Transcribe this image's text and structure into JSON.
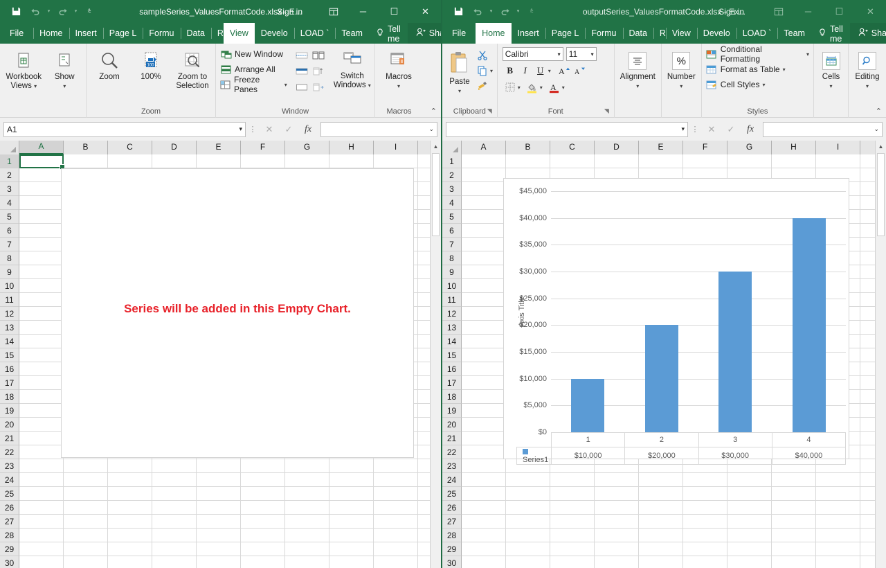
{
  "left_window": {
    "titlebar": {
      "save_icon": "save-icon",
      "undo_icon": "undo-icon",
      "redo_icon": "redo-icon",
      "customize_icon": "customize-qat-icon",
      "title": "sampleSeries_ValuesFormatCode.xlsx",
      "title_suffix": "-  E...",
      "signin": "Sign in",
      "ribbon_display_icon": "ribbon-display-options-icon",
      "minimize": "─",
      "maximize": "☐",
      "close": "✕"
    },
    "tabs": [
      {
        "label": "File",
        "active": false
      },
      {
        "label": "Home",
        "active": false
      },
      {
        "label": "Insert",
        "active": false
      },
      {
        "label": "Page L",
        "active": false
      },
      {
        "label": "Formu",
        "active": false
      },
      {
        "label": "Data",
        "active": false
      },
      {
        "label": "Review",
        "active": false
      },
      {
        "label": "View",
        "active": true
      },
      {
        "label": "Develo",
        "active": false
      },
      {
        "label": "LOAD `",
        "active": false
      },
      {
        "label": "Team",
        "active": false
      }
    ],
    "tellme": "Tell me",
    "share": "Share",
    "ribbon": {
      "groups": [
        {
          "label": "",
          "buttons": [
            {
              "label_line1": "Workbook",
              "label_line2": "Views",
              "icon": "workbook-views-icon",
              "caret": true
            },
            {
              "label_line1": "Show",
              "label_line2": "",
              "icon": "show-icon",
              "caret": true
            }
          ]
        },
        {
          "label": "Zoom",
          "buttons": [
            {
              "label_line1": "Zoom",
              "label_line2": "",
              "icon": "zoom-magnifier-icon",
              "caret": false
            },
            {
              "label_line1": "100%",
              "label_line2": "",
              "icon": "zoom-100-icon",
              "caret": false
            },
            {
              "label_line1": "Zoom to",
              "label_line2": "Selection",
              "icon": "zoom-to-selection-icon",
              "caret": false
            }
          ]
        },
        {
          "label": "Window",
          "items": [
            {
              "label": "New Window",
              "icon": "new-window-icon"
            },
            {
              "label": "Arrange All",
              "icon": "arrange-all-icon"
            },
            {
              "label": "Freeze Panes",
              "icon": "freeze-panes-icon",
              "caret": true
            }
          ],
          "minis": [
            "split-icon",
            "view-side-by-side-icon",
            "hide-icon",
            "synchronous-scrolling-icon",
            "unhide-icon",
            "reset-window-position-icon"
          ],
          "switch_windows": {
            "label_line1": "Switch",
            "label_line2": "Windows",
            "icon": "switch-windows-icon",
            "caret": true
          }
        },
        {
          "label": "Macros",
          "buttons": [
            {
              "label_line1": "Macros",
              "label_line2": "",
              "icon": "macros-icon",
              "caret": true
            }
          ]
        }
      ],
      "collapse_icon": "collapse-ribbon-icon"
    },
    "formula_bar": {
      "name_box_value": "A1",
      "cancel_icon": "cancel-icon",
      "enter_icon": "enter-icon",
      "fx_icon": "insert-function-icon",
      "formula_value": "",
      "expand_icon": "expand-formula-bar-icon"
    },
    "grid": {
      "columns": [
        "A",
        "B",
        "C",
        "D",
        "E",
        "F",
        "G",
        "H",
        "I"
      ],
      "selected_column": "A",
      "rows": [
        1,
        2,
        3,
        4,
        5,
        6,
        7,
        8,
        9,
        10,
        11,
        12,
        13,
        14,
        15,
        16,
        17,
        18,
        19,
        20,
        21,
        22,
        23,
        24,
        25,
        26,
        27,
        28,
        29,
        30
      ],
      "selected_row": 1,
      "selected_cell": "A1"
    },
    "chart_object": {
      "empty_text": "Series will be added in this Empty Chart."
    }
  },
  "right_window": {
    "titlebar": {
      "save_icon": "save-icon",
      "undo_icon": "undo-icon",
      "redo_icon": "redo-icon",
      "customize_icon": "customize-qat-icon",
      "title": "outputSeries_ValuesFormatCode.xlsx",
      "title_suffix": "-  Ex...",
      "signin": "Sign in",
      "ribbon_display_icon": "ribbon-display-options-icon",
      "minimize": "─",
      "maximize": "☐",
      "close": "✕"
    },
    "tabs": [
      {
        "label": "File",
        "active": false
      },
      {
        "label": "Home",
        "active": true
      },
      {
        "label": "Insert",
        "active": false
      },
      {
        "label": "Page L",
        "active": false
      },
      {
        "label": "Formu",
        "active": false
      },
      {
        "label": "Data",
        "active": false
      },
      {
        "label": "Review",
        "active": false
      },
      {
        "label": "View",
        "active": false
      },
      {
        "label": "Develo",
        "active": false
      },
      {
        "label": "LOAD `",
        "active": false
      },
      {
        "label": "Team",
        "active": false
      }
    ],
    "tellme": "Tell me",
    "share": "Share",
    "ribbon": {
      "clipboard": {
        "label": "Clipboard",
        "paste_label": "Paste",
        "paste_icon": "paste-icon",
        "cut_icon": "cut-scissors-icon",
        "copy_icon": "copy-icon",
        "format_painter_icon": "format-painter-icon",
        "dialog_launcher_icon": "dialog-launcher-icon"
      },
      "font": {
        "label": "Font",
        "font_name": "Calibri",
        "font_size": "11",
        "bold": "B",
        "italic": "I",
        "underline": "U",
        "grow_font_icon": "increase-font-size-icon",
        "shrink_font_icon": "decrease-font-size-icon",
        "borders_icon": "borders-icon",
        "fill_color_icon": "fill-color-icon",
        "font_color_icon": "font-color-icon",
        "dialog_launcher_icon": "dialog-launcher-icon"
      },
      "alignment": {
        "label": "Alignment",
        "icon": "alignment-icon"
      },
      "number": {
        "label": "Number",
        "icon": "percent-style-icon"
      },
      "styles": {
        "label": "Styles",
        "items": [
          {
            "label": "Conditional Formatting",
            "icon": "conditional-formatting-icon",
            "caret": true
          },
          {
            "label": "Format as Table",
            "icon": "format-as-table-icon",
            "caret": true
          },
          {
            "label": "Cell Styles",
            "icon": "cell-styles-icon",
            "caret": true
          }
        ]
      },
      "cells": {
        "label": "Cells",
        "icon": "cells-icon",
        "caret": true
      },
      "editing": {
        "label": "Editing",
        "icon": "editing-magnifier-icon",
        "caret": true
      },
      "collapse_icon": "collapse-ribbon-icon"
    },
    "formula_bar": {
      "name_box_value": "",
      "cancel_icon": "cancel-icon",
      "enter_icon": "enter-icon",
      "fx_icon": "insert-function-icon",
      "formula_value": "",
      "expand_icon": "expand-formula-bar-icon"
    },
    "grid": {
      "columns": [
        "A",
        "B",
        "C",
        "D",
        "E",
        "F",
        "G",
        "H",
        "I"
      ],
      "rows": [
        1,
        2,
        3,
        4,
        5,
        6,
        7,
        8,
        9,
        10,
        11,
        12,
        13,
        14,
        15,
        16,
        17,
        18,
        19,
        20,
        21,
        22,
        23,
        24,
        25,
        26,
        27,
        28,
        29,
        30
      ]
    }
  },
  "chart_data": {
    "type": "bar",
    "title": "",
    "xlabel": "",
    "ylabel": "Axis Title",
    "categories": [
      "1",
      "2",
      "3",
      "4"
    ],
    "series": [
      {
        "name": "Series1",
        "values": [
          10000,
          20000,
          30000,
          40000
        ],
        "formatted_values": [
          "$10,000",
          "$20,000",
          "$30,000",
          "$40,000"
        ],
        "color": "#5b9bd5"
      }
    ],
    "ylim": [
      0,
      45000
    ],
    "ytick_step": 5000,
    "ytick_labels": [
      "$45,000",
      "$40,000",
      "$35,000",
      "$30,000",
      "$25,000",
      "$20,000",
      "$15,000",
      "$10,000",
      "$5,000",
      "$0"
    ],
    "ytick_values": [
      45000,
      40000,
      35000,
      30000,
      25000,
      20000,
      15000,
      10000,
      5000,
      0
    ],
    "grid": true,
    "legend_position": "data-table",
    "data_table_visible": true,
    "number_format": "$#,##0"
  },
  "colors": {
    "excel_green": "#217346",
    "bar_blue": "#5b9bd5",
    "empty_chart_red": "#e8222a",
    "ribbon_bg": "#f0f0f0"
  }
}
